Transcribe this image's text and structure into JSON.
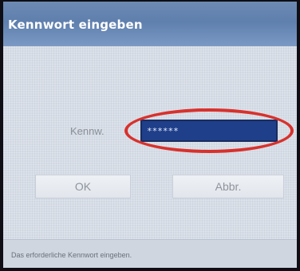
{
  "dialog": {
    "title": "Kennwort eingeben"
  },
  "form": {
    "password_label": "Kennw.",
    "password_value": "******",
    "highlight_color": "#d8312c",
    "input_bg_color": "#1f3f8a"
  },
  "buttons": {
    "ok_label": "OK",
    "cancel_label": "Abbr."
  },
  "status": {
    "message": "Das erforderliche Kennwort eingeben."
  }
}
